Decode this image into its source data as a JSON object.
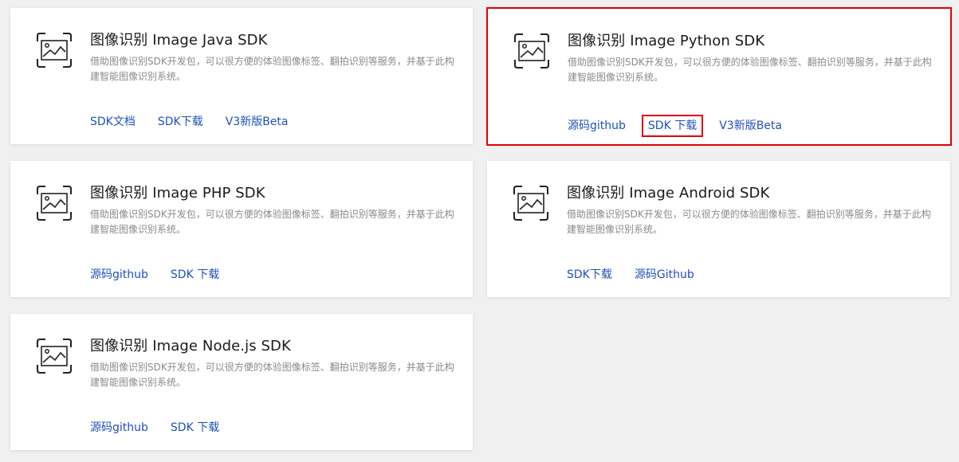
{
  "colors": {
    "background": "#f0f0f0",
    "card": "#ffffff",
    "title": "#1a1a1a",
    "description": "#8a8a8a",
    "link": "#1f4fbf",
    "highlight": "#e0000b"
  },
  "cards": [
    {
      "icon": "image-recognition-icon",
      "title": "图像识别 Image Java SDK",
      "description": "借助图像识别SDK开发包，可以很方便的体验图像标签、翻拍识别等服务，并基于此构建智能图像识别系统。",
      "links": [
        "SDK文档",
        "SDK下载",
        "V3新版Beta"
      ]
    },
    {
      "icon": "image-recognition-icon",
      "title": "图像识别 Image Python SDK",
      "description": "借助图像识别SDK开发包，可以很方便的体验图像标签、翻拍识别等服务，并基于此构建智能图像识别系统。",
      "links": [
        "源码github",
        "SDK 下载",
        "V3新版Beta"
      ]
    },
    {
      "icon": "image-recognition-icon",
      "title": "图像识别 Image PHP SDK",
      "description": "借助图像识别SDK开发包，可以很方便的体验图像标签、翻拍识别等服务，并基于此构建智能图像识别系统。",
      "links": [
        "源码github",
        "SDK 下载"
      ]
    },
    {
      "icon": "image-recognition-icon",
      "title": "图像识别 Image Android SDK",
      "description": "借助图像识别SDK开发包，可以很方便的体验图像标签、翻拍识别等服务，并基于此构建智能图像识别系统。",
      "links": [
        "SDK下载",
        "源码Github"
      ]
    },
    {
      "icon": "image-recognition-icon",
      "title": "图像识别 Image Node.js SDK",
      "description": "借助图像识别SDK开发包，可以很方便的体验图像标签、翻拍识别等服务，并基于此构建智能图像识别系统。",
      "links": [
        "源码github",
        "SDK 下载"
      ]
    }
  ]
}
